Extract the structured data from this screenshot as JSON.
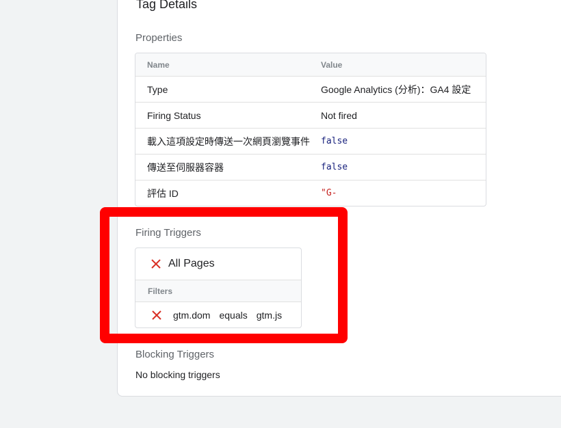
{
  "tag_details": {
    "title": "Tag Details"
  },
  "properties": {
    "section_title": "Properties",
    "headers": {
      "name": "Name",
      "value": "Value"
    },
    "rows": [
      {
        "name": "Type",
        "value": "Google Analytics (分析)：GA4 設定"
      },
      {
        "name": "Firing Status",
        "value": "Not fired"
      },
      {
        "name": "載入這項設定時傳送一次網頁瀏覽事件",
        "value": "false"
      },
      {
        "name": "傳送至伺服器容器",
        "value": "false"
      },
      {
        "name": "評估 ID",
        "value": "\"G-"
      }
    ]
  },
  "firing_triggers": {
    "section_title": "Firing Triggers",
    "trigger_name": "All Pages",
    "filters_label": "Filters",
    "filter": {
      "variable": "gtm.dom",
      "operator": "equals",
      "value": "gtm.js"
    }
  },
  "blocking_triggers": {
    "section_title": "Blocking Triggers",
    "empty_text": "No blocking triggers"
  },
  "colors": {
    "highlight": "#ff0000",
    "not_fired_icon": "#d93025"
  },
  "icons": {
    "trigger_status": "close-icon",
    "filter_status": "close-icon"
  }
}
